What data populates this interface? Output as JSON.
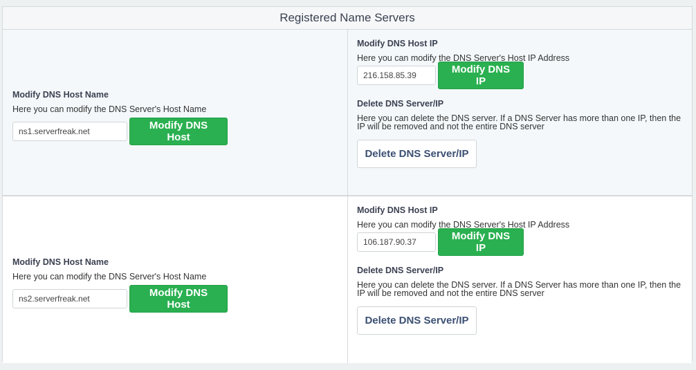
{
  "panel": {
    "title": "Registered Name Servers"
  },
  "servers": [
    {
      "host_label": "Modify DNS Host Name",
      "host_help": "Here you can modify the DNS Server's Host Name",
      "host_value": "ns1.serverfreak.net",
      "host_button": "Modify DNS Host",
      "ip_label": "Modify DNS Host IP",
      "ip_help": "Here you can modify the DNS Server's Host IP Address",
      "ip_value": "216.158.85.39",
      "ip_button": "Modify DNS IP",
      "delete_label": "Delete DNS Server/IP",
      "delete_help_line1": "Here you can delete the DNS server. If a DNS Server has more than one IP, then the",
      "delete_help_line2": "IP will be removed and not the entire DNS server",
      "delete_button": "Delete DNS Server/IP"
    },
    {
      "host_label": "Modify DNS Host Name",
      "host_help": "Here you can modify the DNS Server's Host Name",
      "host_value": "ns2.serverfreak.net",
      "host_button": "Modify DNS Host",
      "ip_label": "Modify DNS Host IP",
      "ip_help": "Here you can modify the DNS Server's Host IP Address",
      "ip_value": "106.187.90.37",
      "ip_button": "Modify DNS IP",
      "delete_label": "Delete DNS Server/IP",
      "delete_help_line1": "Here you can delete the DNS server. If a DNS Server has more than one IP, then the",
      "delete_help_line2": "IP will be removed and not the entire DNS server",
      "delete_button": "Delete DNS Server/IP"
    }
  ],
  "colors": {
    "primary_button": "#2ab050",
    "heading_text": "#3b4151",
    "secondary_button_text": "#3b4f73"
  }
}
